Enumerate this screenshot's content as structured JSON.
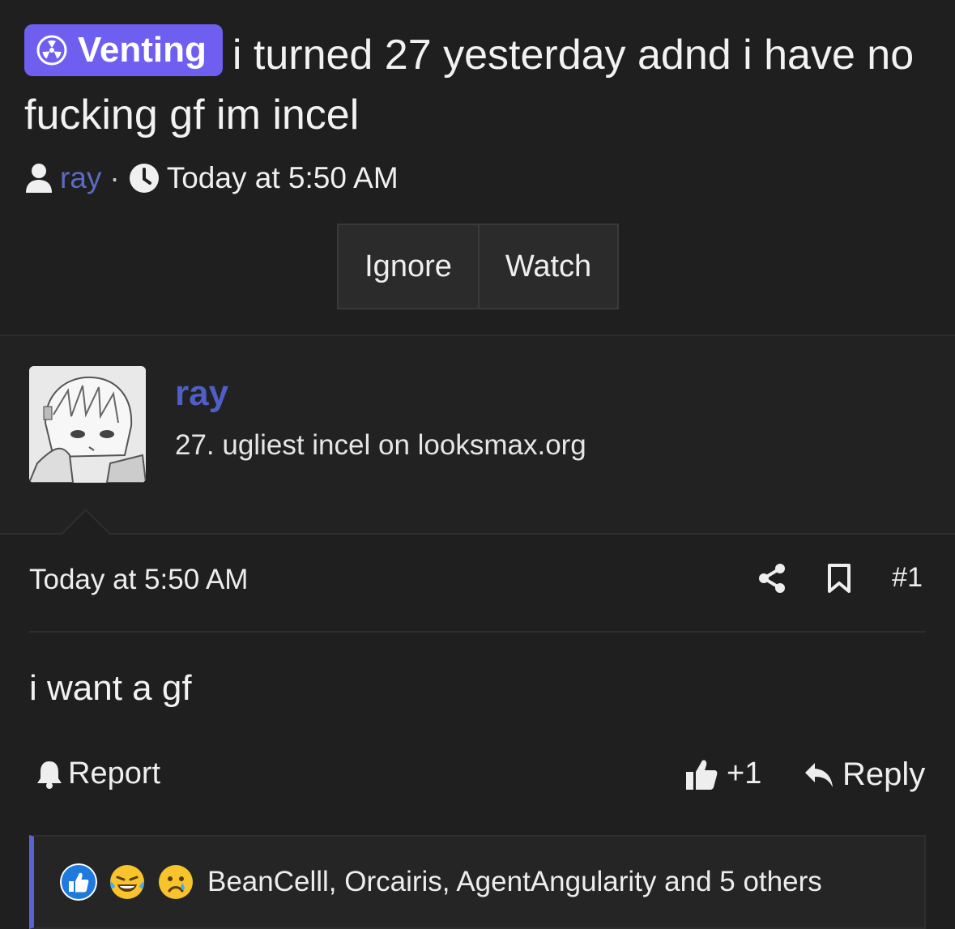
{
  "thread": {
    "prefix": "Venting",
    "title": "i turned 27 yesterday adnd i have no fucking gf im incel",
    "author": "ray",
    "date": "Today at 5:50 AM",
    "buttons": {
      "ignore": "Ignore",
      "watch": "Watch"
    }
  },
  "post": {
    "username": "ray",
    "user_title": "27. ugliest incel on looksmax.org",
    "date": "Today at 5:50 AM",
    "number": "#1",
    "body": "i want a gf",
    "report_label": "Report",
    "like_count": "+1",
    "reply_label": "Reply",
    "reactions_text": "BeanCelll, Orcairis, AgentAngularity and 5 others"
  },
  "colors": {
    "prefix_bg": "#6f5ff0",
    "username": "#4f5fc7",
    "background": "#1f1f20",
    "reaction_bar": "#5b63d3"
  }
}
